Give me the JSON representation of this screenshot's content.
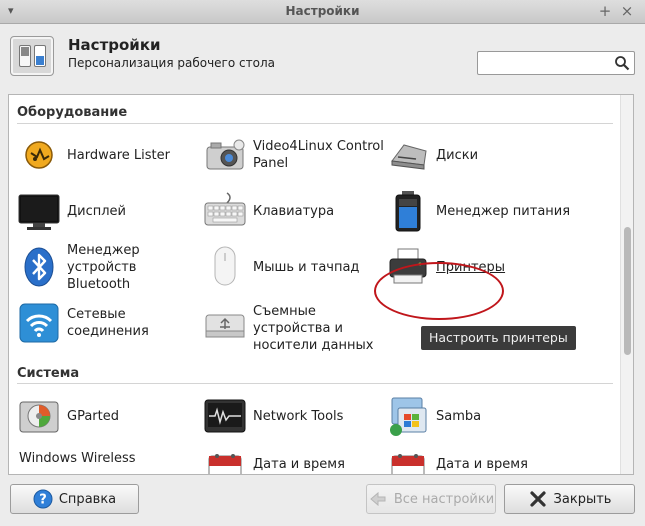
{
  "window": {
    "title": "Настройки",
    "menu_glyph": "▾",
    "maximize_glyph": "+",
    "close_glyph": "×"
  },
  "header": {
    "title": "Настройки",
    "subtitle": "Персонализация рабочего стола",
    "search_value": ""
  },
  "sections": [
    {
      "title": "Оборудование",
      "items": [
        {
          "label": "Hardware Lister",
          "icon": "hardware-lister-icon"
        },
        {
          "label": "Video4Linux Control Panel",
          "icon": "webcam-icon"
        },
        {
          "label": "Диски",
          "icon": "disks-icon"
        },
        {
          "label": "Дисплей",
          "icon": "display-icon"
        },
        {
          "label": "Клавиатура",
          "icon": "keyboard-icon"
        },
        {
          "label": "Менеджер питания",
          "icon": "battery-icon"
        },
        {
          "label": "Менеджер устройств Bluetooth",
          "icon": "bluetooth-icon"
        },
        {
          "label": "Мышь и тачпад",
          "icon": "mouse-icon"
        },
        {
          "label": "Принтеры",
          "icon": "printer-icon"
        },
        {
          "label": "Сетевые соединения",
          "icon": "wifi-icon"
        },
        {
          "label": "Съемные устройства и носители данных",
          "icon": "removable-drive-icon"
        }
      ]
    },
    {
      "title": "Система",
      "items": [
        {
          "label": "GParted",
          "icon": "gparted-icon"
        },
        {
          "label": "Network Tools",
          "icon": "network-tools-icon"
        },
        {
          "label": "Samba",
          "icon": "samba-icon"
        },
        {
          "label": "Windows Wireless",
          "icon": "windows-wireless-icon"
        },
        {
          "label": "Дата и время",
          "icon": "calendar-icon"
        },
        {
          "label": "Дата и время",
          "icon": "calendar-icon"
        }
      ]
    }
  ],
  "tooltip": "Настроить принтеры",
  "footer": {
    "help_label": "Справка",
    "all_settings_label": "Все настройки",
    "close_label": "Закрыть"
  },
  "colors": {
    "highlight_circle": "#c0161b",
    "tooltip_bg": "#3b3b3b"
  }
}
